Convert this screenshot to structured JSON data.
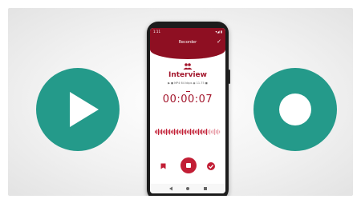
{
  "status_bar": {
    "time": "1:11",
    "signal": "▾◢ ▮"
  },
  "app_bar": {
    "title": "Recorder"
  },
  "recording": {
    "title": "Interview",
    "meta": "▶ ◼ MP4 64 kbps  ◉  11.75  ◼",
    "timer": "00:00:07"
  },
  "colors": {
    "accent_teal": "#249a8a",
    "app_red": "#8e0f22",
    "title_red": "#a3162c",
    "stop_red": "#c21e35"
  },
  "icons": {
    "play": "play-icon",
    "record": "record-icon",
    "people": "people-icon",
    "bookmark": "bookmark-icon",
    "stop": "stop-icon",
    "done": "check-icon"
  }
}
